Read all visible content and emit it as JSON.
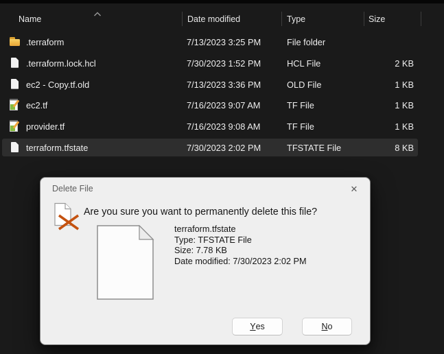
{
  "explorer": {
    "header": {
      "name": "Name",
      "date_modified": "Date modified",
      "type": "Type",
      "size": "Size",
      "sort_icon": "chevron-up"
    },
    "rows": [
      {
        "icon": "folder",
        "name": ".terraform",
        "date": "7/13/2023 3:25 PM",
        "type": "File folder",
        "size": ""
      },
      {
        "icon": "file",
        "name": ".terraform.lock.hcl",
        "date": "7/30/2023 1:52 PM",
        "type": "HCL File",
        "size": "2 KB"
      },
      {
        "icon": "file",
        "name": "ec2 - Copy.tf.old",
        "date": "7/13/2023 3:36 PM",
        "type": "OLD File",
        "size": "1 KB"
      },
      {
        "icon": "tf",
        "name": "ec2.tf",
        "date": "7/16/2023 9:07 AM",
        "type": "TF File",
        "size": "1 KB"
      },
      {
        "icon": "tf",
        "name": "provider.tf",
        "date": "7/16/2023 9:08 AM",
        "type": "TF File",
        "size": "1 KB"
      },
      {
        "icon": "file",
        "name": "terraform.tfstate",
        "date": "7/30/2023 2:02 PM",
        "type": "TFSTATE File",
        "size": "8 KB",
        "selected": "true"
      }
    ]
  },
  "dialog": {
    "title": "Delete File",
    "close_glyph": "✕",
    "question": "Are you sure you want to permanently delete this file?",
    "file_details": {
      "name": "terraform.tfstate",
      "type_line": "Type: TFSTATE File",
      "size_line": "Size: 7.78 KB",
      "date_line": "Date modified: 7/30/2023 2:02 PM"
    },
    "buttons": {
      "yes_key": "Y",
      "yes_rest": "es",
      "no_key": "N",
      "no_rest": "o"
    }
  },
  "colors": {
    "explorer_bg": "#1a1a1a",
    "row_highlight": "#2e2e2e",
    "dialog_bg": "#efefef",
    "delete_x": "#c45210",
    "folder_yellow": "#f1b948"
  }
}
